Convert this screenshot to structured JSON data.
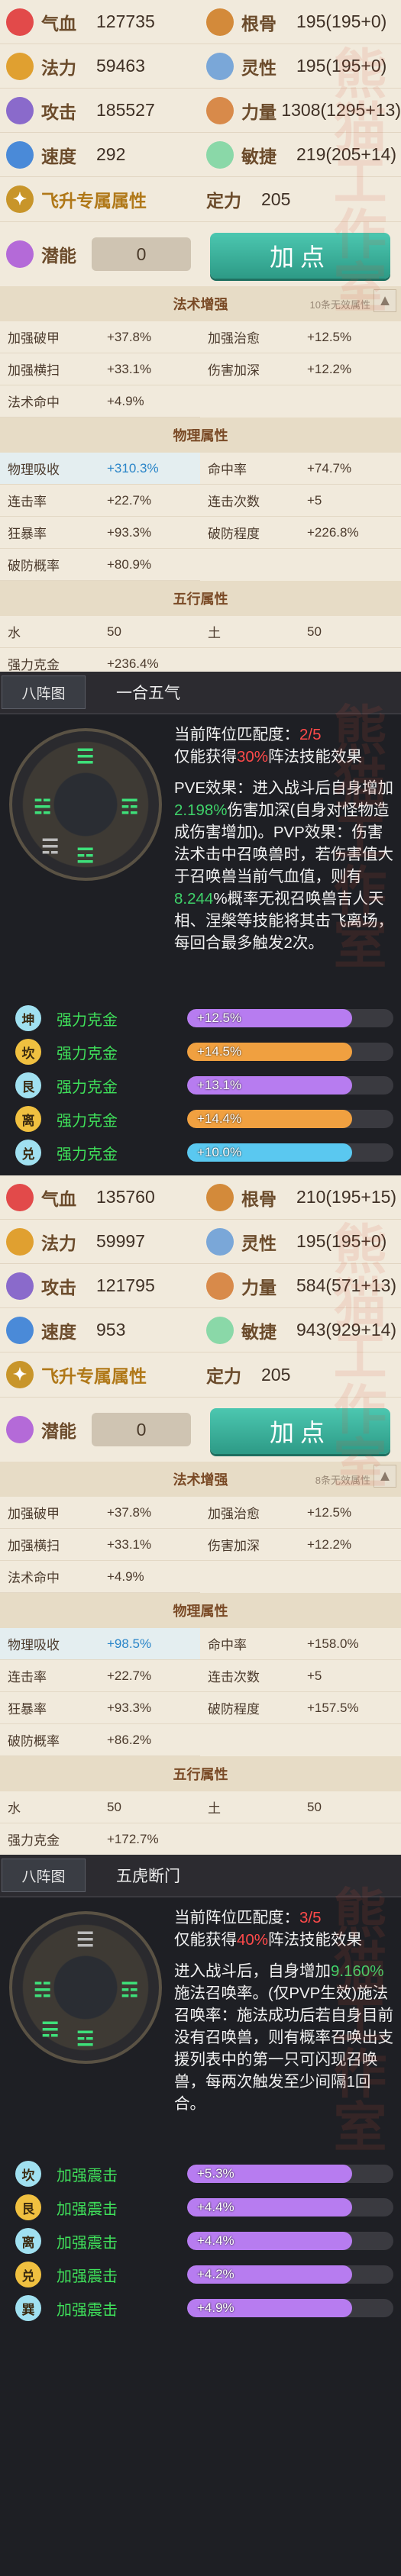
{
  "panel1": {
    "stats": [
      {
        "icon": "heart-icon",
        "label": "气血",
        "value": "127735",
        "color": "#e24a4a"
      },
      {
        "icon": "bone-icon",
        "label": "根骨",
        "value": "195(195+0)",
        "color": "#d38a3a"
      },
      {
        "icon": "mana-icon",
        "label": "法力",
        "value": "59463",
        "color": "#e0a030"
      },
      {
        "icon": "spirit-icon",
        "label": "灵性",
        "value": "195(195+0)",
        "color": "#7aa7d8"
      },
      {
        "icon": "sword-icon",
        "label": "攻击",
        "value": "185527",
        "color": "#8a6acb"
      },
      {
        "icon": "fist-icon",
        "label": "力量",
        "value": "1308(1295+13)",
        "color": "#d88a4a"
      },
      {
        "icon": "boot-icon",
        "label": "速度",
        "value": "292",
        "color": "#4a8ad8"
      },
      {
        "icon": "wing-icon",
        "label": "敏捷",
        "value": "219(205+14)",
        "color": "#8ad8a8"
      }
    ],
    "fly_label": "飞升专属属性",
    "ding_label": "定力",
    "ding_value": "205",
    "potential_label": "潜能",
    "potential_value": "0",
    "add_button": "加点",
    "spell_title": "法术增强",
    "spell_note": "10条无效属性",
    "spell_rows": [
      [
        "加强破甲",
        "+37.8%"
      ],
      [
        "加强治愈",
        "+12.5%"
      ],
      [
        "加强横扫",
        "+33.1%"
      ],
      [
        "伤害加深",
        "+12.2%"
      ],
      [
        "法术命中",
        "+4.9%"
      ]
    ],
    "phys_title": "物理属性",
    "phys_rows": [
      [
        "物理吸收",
        "+310.3%"
      ],
      [
        "命中率",
        "+74.7%"
      ],
      [
        "连击率",
        "+22.7%"
      ],
      [
        "连击次数",
        "+5"
      ],
      [
        "狂暴率",
        "+93.3%"
      ],
      [
        "破防程度",
        "+226.8%"
      ],
      [
        "破防概率",
        "+80.9%"
      ]
    ],
    "five_title": "五行属性",
    "five_rows": [
      [
        "水",
        "50"
      ],
      [
        "土",
        "50"
      ],
      [
        "强力克金",
        "+236.4%"
      ]
    ]
  },
  "form1": {
    "tab": "八阵图",
    "name": "一合五气",
    "match_label": "当前阵位匹配度：",
    "match_value": "2/5",
    "gain_pre": "仅能获得",
    "gain_value": "30%",
    "gain_post": "阵法技能效果",
    "body_lines": [
      "PVE效果：进入战斗后自身",
      "增加",
      "2.198%",
      "伤害加深(自身",
      "对怪物造成伤害增加)。",
      "PVP效果：伤害法术击中召唤",
      "兽时，若伤害值大于召唤",
      "兽当前气血值，则有",
      "8.244",
      "%概率无视召唤兽吉人天相、",
      "涅槃等技能将其击飞离场，",
      "每回合最多触发2次。"
    ],
    "bars": [
      {
        "icon": "坤",
        "name": "强力克金",
        "value": "+12.5%",
        "pct": 0.8,
        "color": "#b77cf0"
      },
      {
        "icon": "坎",
        "name": "强力克金",
        "value": "+14.5%",
        "pct": 0.8,
        "color": "#f0a040"
      },
      {
        "icon": "艮",
        "name": "强力克金",
        "value": "+13.1%",
        "pct": 0.8,
        "color": "#b77cf0"
      },
      {
        "icon": "离",
        "name": "强力克金",
        "value": "+14.4%",
        "pct": 0.8,
        "color": "#f0a040"
      },
      {
        "icon": "兑",
        "name": "强力克金",
        "value": "+10.0%",
        "pct": 0.8,
        "color": "#5ac8f0"
      }
    ]
  },
  "panel2": {
    "stats": [
      {
        "icon": "heart-icon",
        "label": "气血",
        "value": "135760",
        "color": "#e24a4a"
      },
      {
        "icon": "bone-icon",
        "label": "根骨",
        "value": "210(195+15)",
        "color": "#d38a3a"
      },
      {
        "icon": "mana-icon",
        "label": "法力",
        "value": "59997",
        "color": "#e0a030"
      },
      {
        "icon": "spirit-icon",
        "label": "灵性",
        "value": "195(195+0)",
        "color": "#7aa7d8"
      },
      {
        "icon": "sword-icon",
        "label": "攻击",
        "value": "121795",
        "color": "#8a6acb"
      },
      {
        "icon": "fist-icon",
        "label": "力量",
        "value": "584(571+13)",
        "color": "#d88a4a"
      },
      {
        "icon": "boot-icon",
        "label": "速度",
        "value": "953",
        "color": "#4a8ad8"
      },
      {
        "icon": "wing-icon",
        "label": "敏捷",
        "value": "943(929+14)",
        "color": "#8ad8a8"
      }
    ],
    "fly_label": "飞升专属属性",
    "ding_label": "定力",
    "ding_value": "205",
    "potential_label": "潜能",
    "potential_value": "0",
    "add_button": "加点",
    "spell_title": "法术增强",
    "spell_note": "8条无效属性",
    "spell_rows": [
      [
        "加强破甲",
        "+37.8%"
      ],
      [
        "加强治愈",
        "+12.5%"
      ],
      [
        "加强横扫",
        "+33.1%"
      ],
      [
        "伤害加深",
        "+12.2%"
      ],
      [
        "法术命中",
        "+4.9%"
      ]
    ],
    "phys_title": "物理属性",
    "phys_rows": [
      [
        "物理吸收",
        "+98.5%"
      ],
      [
        "命中率",
        "+158.0%"
      ],
      [
        "连击率",
        "+22.7%"
      ],
      [
        "连击次数",
        "+5"
      ],
      [
        "狂暴率",
        "+93.3%"
      ],
      [
        "破防程度",
        "+157.5%"
      ],
      [
        "破防概率",
        "+86.2%"
      ]
    ],
    "five_title": "五行属性",
    "five_rows": [
      [
        "水",
        "50"
      ],
      [
        "土",
        "50"
      ],
      [
        "强力克金",
        "+172.7%"
      ]
    ]
  },
  "form2": {
    "tab": "八阵图",
    "name": "五虎断门",
    "match_label": "当前阵位匹配度：",
    "match_value": "3/5",
    "gain_pre": "仅能获得",
    "gain_value": "40%",
    "gain_post": "阵法技能效果",
    "body_lines": [
      "进入战斗后，自身增加",
      "9.16",
      "0%",
      "施法召唤率。(仅PVP生效)",
      "施法召唤率：施法成功后若自身目前没有召唤兽，则有概率召唤出支援列表中的第一只可闪现召唤兽，每两次触发至少间隔1回合。"
    ],
    "bars": [
      {
        "icon": "坎",
        "name": "加强震击",
        "value": "+5.3%",
        "pct": 0.8,
        "color": "#b77cf0"
      },
      {
        "icon": "艮",
        "name": "加强震击",
        "value": "+4.4%",
        "pct": 0.8,
        "color": "#b77cf0"
      },
      {
        "icon": "离",
        "name": "加强震击",
        "value": "+4.4%",
        "pct": 0.8,
        "color": "#b77cf0"
      },
      {
        "icon": "兑",
        "name": "加强震击",
        "value": "+4.2%",
        "pct": 0.8,
        "color": "#b77cf0"
      },
      {
        "icon": "巽",
        "name": "加强震击",
        "value": "+4.9%",
        "pct": 0.8,
        "color": "#b77cf0"
      }
    ]
  }
}
